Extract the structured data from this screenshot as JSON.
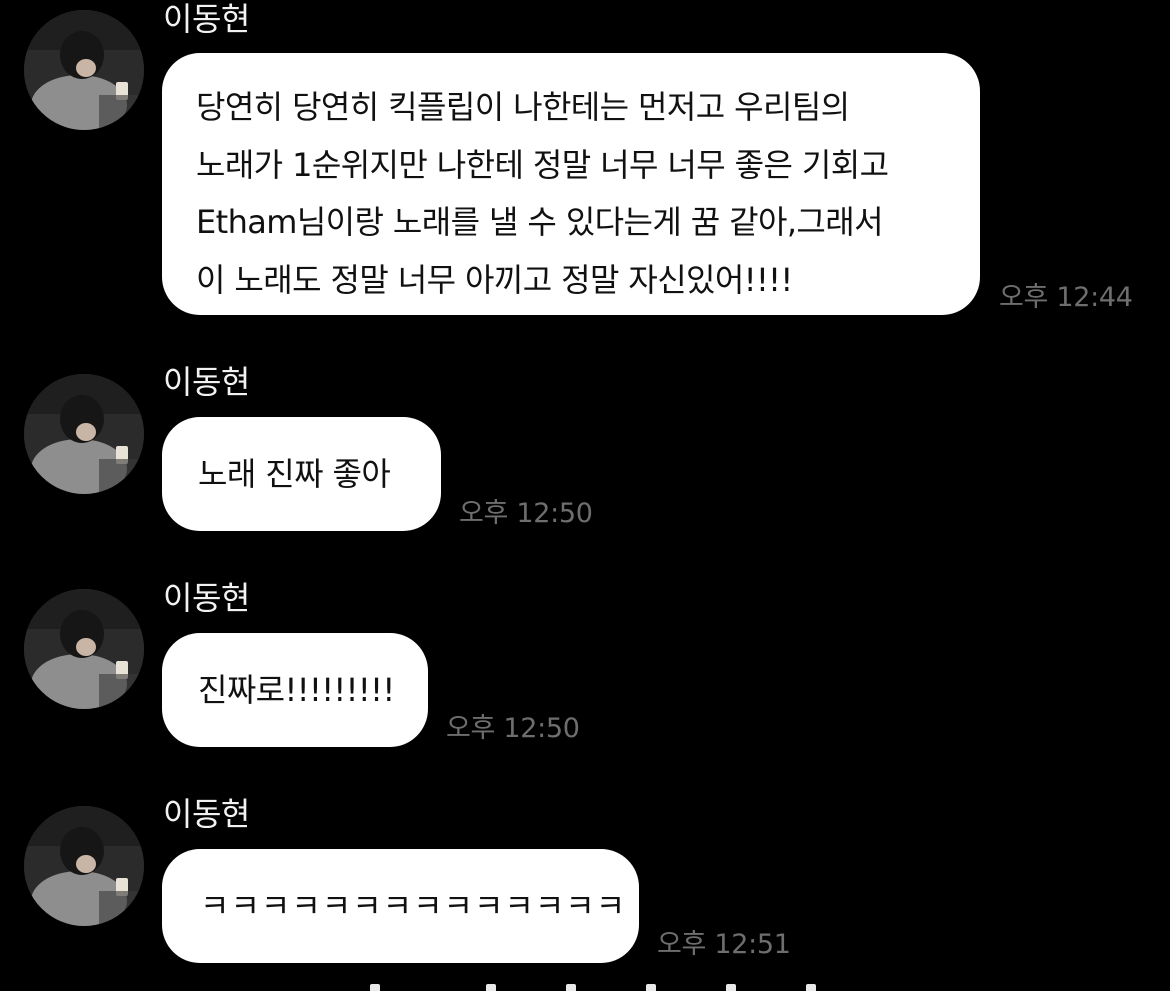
{
  "chat": {
    "messages": [
      {
        "sender": "이동현",
        "lines": [
          " 당연히 당연히 킥플립이 나한테는 먼저고 우리팀의",
          "노래가 1순위지만 나한테 정말 너무 너무 좋은 기회고",
          "Etham님이랑 노래를 낼 수 있다는게 꿈 같아,그래서",
          "이 노래도 정말 너무 아끼고 정말 자신있어!!!!"
        ],
        "time": "오후 12:44"
      },
      {
        "sender": "이동현",
        "lines": [
          "노래 진짜 좋아"
        ],
        "time": "오후 12:50"
      },
      {
        "sender": "이동현",
        "lines": [
          "진짜로!!!!!!!!!"
        ],
        "time": "오후 12:50"
      },
      {
        "sender": "이동현",
        "lines": [
          "ㅋㅋㅋㅋㅋㅋㅋㅋㅋㅋㅋㅋㅋㅋ"
        ],
        "time": "오후 12:51"
      }
    ]
  },
  "colors": {
    "background": "#000000",
    "bubble": "#ffffff",
    "sender_text": "#f2f2f2",
    "time_text": "#6e6e6e"
  },
  "icons": {
    "avatar": "profile-photo"
  }
}
